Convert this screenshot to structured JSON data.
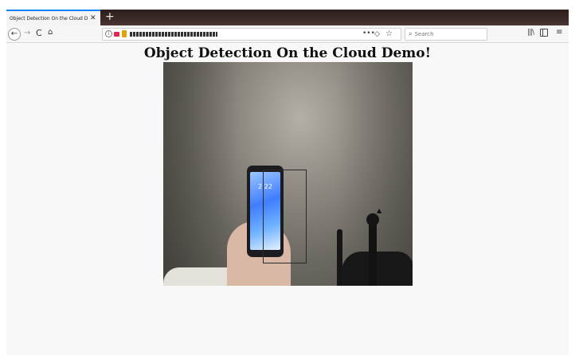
{
  "browser": {
    "tab": {
      "title": "Object Detection On the Cloud Demo!",
      "close_symbol": "✕"
    },
    "new_tab_symbol": "+",
    "nav": {
      "back": "←",
      "forward": "→",
      "reload": "C",
      "home": "⌂"
    },
    "urlbar": {
      "overflow": "•••",
      "shield": "◇",
      "bookmark": "☆"
    },
    "search": {
      "placeholder": "Search"
    },
    "toolbar": {
      "library": "|||\\",
      "menu": "≡"
    },
    "colors": {
      "tab_accent": "#0a84ff",
      "camera_indicator": "#e22850"
    }
  },
  "page": {
    "title": "Object Detection On the Cloud Demo!",
    "video_feed": {
      "phone_time": "2:22"
    }
  }
}
